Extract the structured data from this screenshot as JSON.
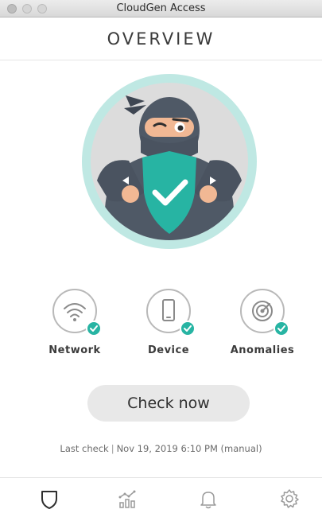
{
  "window": {
    "title": "CloudGen Access"
  },
  "header": {
    "title": "OVERVIEW"
  },
  "status_items": [
    {
      "label": "Network",
      "icon": "wifi-icon",
      "checked": true
    },
    {
      "label": "Device",
      "icon": "device-icon",
      "checked": true
    },
    {
      "label": "Anomalies",
      "icon": "radar-icon",
      "checked": true
    }
  ],
  "check_now": {
    "label": "Check now"
  },
  "last_check": {
    "label": "Last check",
    "separator": "|",
    "value": "Nov 19, 2019 6:10 PM (manual)"
  },
  "tabbar": {
    "tabs": [
      {
        "icon": "shield-icon",
        "active": true
      },
      {
        "icon": "chart-icon",
        "active": false
      },
      {
        "icon": "bell-icon",
        "active": false
      },
      {
        "icon": "gear-icon",
        "active": false
      }
    ]
  },
  "colors": {
    "accent": "#27b4a3",
    "hero_ring": "#bfe8e3",
    "hero_bg": "#dcdcdc",
    "ninja": "#4f5966",
    "skin": "#f1b894",
    "shield": "#27b4a3"
  }
}
